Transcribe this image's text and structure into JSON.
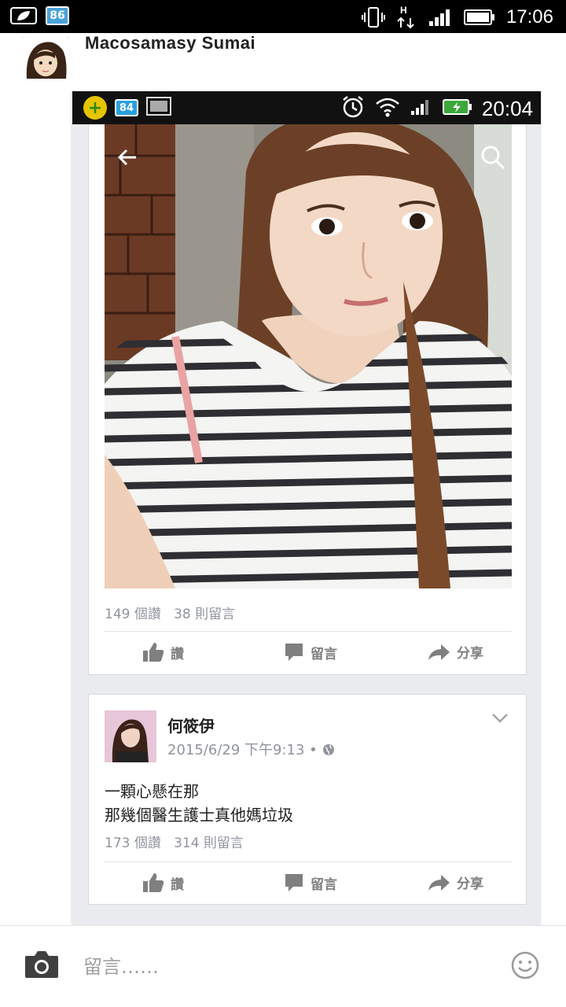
{
  "outer_status": {
    "time": "17:06",
    "badge": "86"
  },
  "commenter": {
    "name": "Macosamasy Sumai"
  },
  "inner_status": {
    "time": "20:04",
    "badge": "84"
  },
  "post1": {
    "likes": "149 個讚",
    "comments": "38 則留言",
    "actions": {
      "like": "讚",
      "comment": "留言",
      "share": "分享"
    }
  },
  "post2": {
    "author": "何筱伊",
    "timestamp": "2015/6/29 下午9:13 •",
    "text_line1": "一顆心懸在那",
    "text_line2": "那幾個醫生護士真他媽垃圾",
    "likes": "173 個讚",
    "comments": "314 則留言",
    "actions": {
      "like": "讚",
      "comment": "留言",
      "share": "分享"
    }
  },
  "comment_bar": {
    "placeholder": "留言……"
  },
  "colors": {
    "action_gray": "#7f7f7f",
    "meta_gray": "#90949c",
    "background": "#e9ebee"
  }
}
